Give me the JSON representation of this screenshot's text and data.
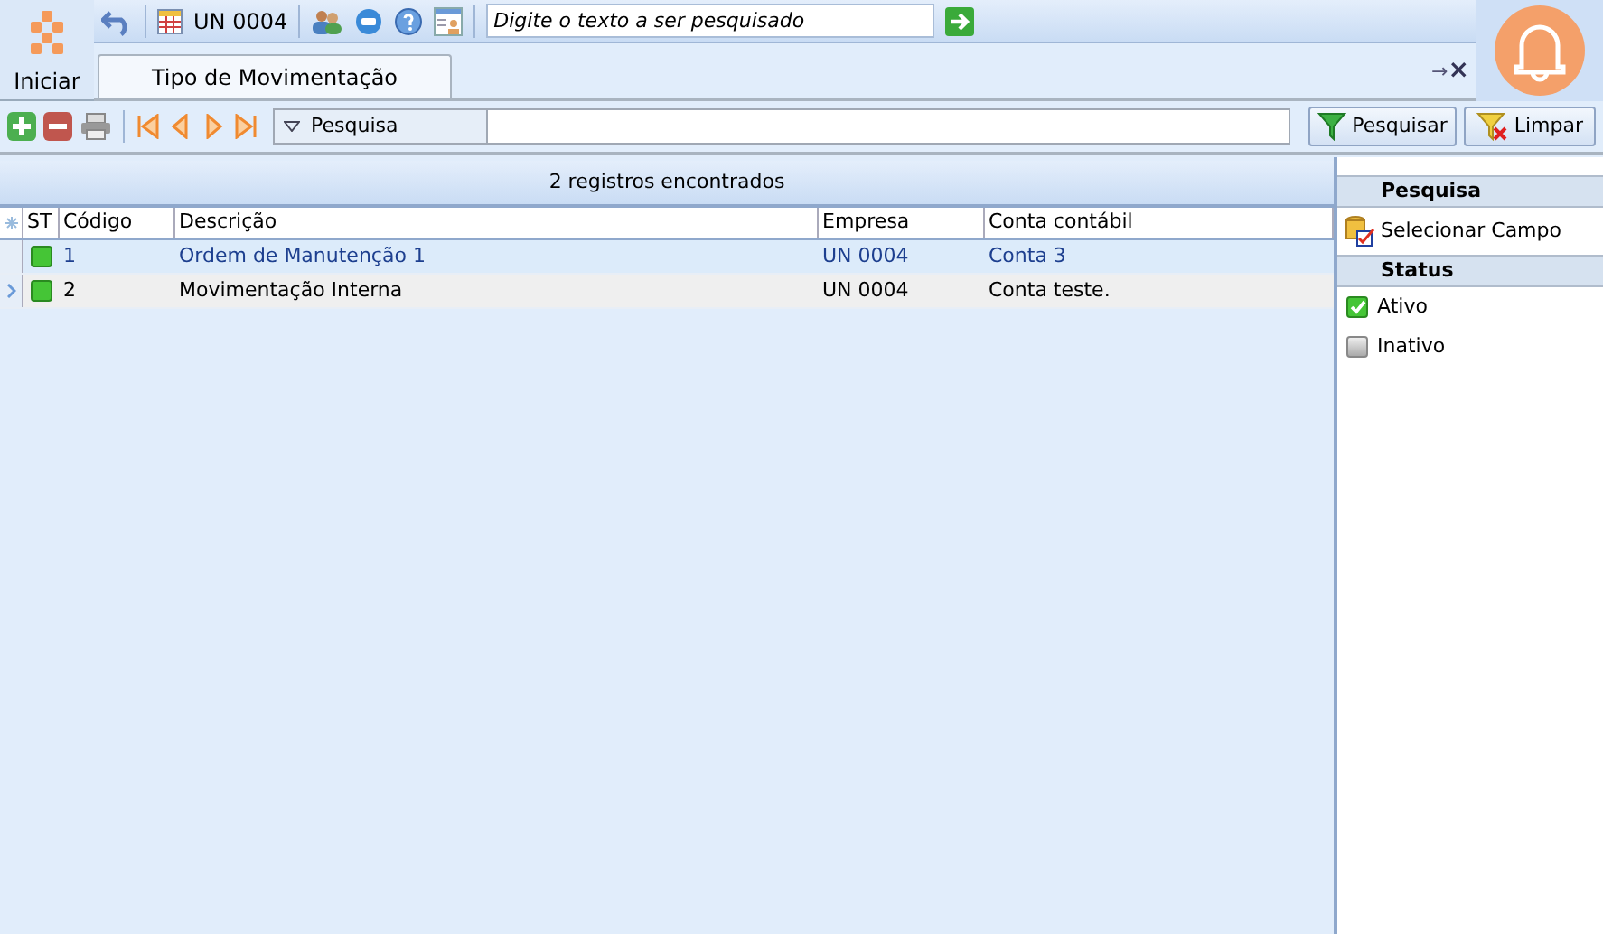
{
  "start": {
    "label": "Iniciar"
  },
  "toolbar": {
    "company": "UN 0004",
    "search": {
      "placeholder": "Digite o texto a ser pesquisado"
    }
  },
  "tabs": [
    {
      "label": "Tipo de Movimentação",
      "selected": true
    }
  ],
  "tab_controls": {
    "pin": "→",
    "close": "×"
  },
  "filter_bar": {
    "field": "Pesquisa",
    "search_button": "Pesquisar",
    "clear_button": "Limpar"
  },
  "grid": {
    "summary": "2 registros encontrados",
    "columns": [
      "ST",
      "Código",
      "Descrição",
      "Empresa",
      "Conta contábil"
    ],
    "rows": [
      {
        "selected": false,
        "active": true,
        "code": "1",
        "description": "Ordem de Manutenção 1",
        "company": "UN 0004",
        "account": "Conta 3"
      },
      {
        "selected": true,
        "active": true,
        "code": "2",
        "description": "Movimentação Interna",
        "company": "UN 0004",
        "account": "Conta teste."
      }
    ]
  },
  "side_panel": {
    "search_heading": "Pesquisa",
    "select_field": "Selecionar Campo",
    "status_heading": "Status",
    "status": [
      {
        "label": "Ativo",
        "checked": true
      },
      {
        "label": "Inativo",
        "checked": false
      }
    ]
  }
}
